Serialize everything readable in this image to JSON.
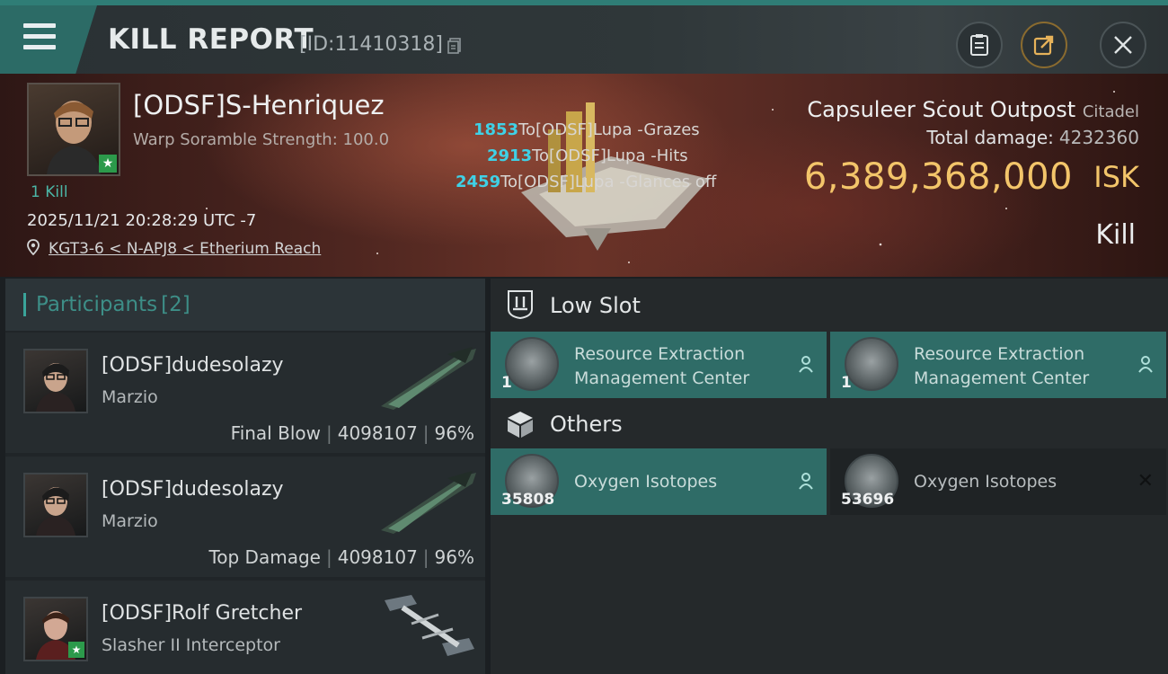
{
  "header": {
    "title": "KILL REPORT",
    "report_id": "[ID:11410318]"
  },
  "victim": {
    "name": "[ODSF]S-Henriquez",
    "scramble": "Warp Soramble Strength: 100.0",
    "kill_count": "1 Kill",
    "datetime": "2025/11/21 20:28:29 UTC -7",
    "location": "KGT3-6 < N-APJ8 < Etherium Reach"
  },
  "damage_log": [
    {
      "amount": "1853",
      "text": "To[ODSF]Lupa -Grazes"
    },
    {
      "amount": "2913",
      "text": "To[ODSF]Lupa -Hits"
    },
    {
      "amount": "2459",
      "text": "To[ODSF]Lupa -Glances off"
    }
  ],
  "target": {
    "name": "Capsuleer Scout Outpost",
    "type": "Citadel",
    "total_damage_label": "Total damage:",
    "total_damage": "4232360",
    "isk_value": "6,389,368,000",
    "isk_label": "ISK",
    "result": "Kill"
  },
  "participants": {
    "label": "Participants",
    "count": "[2]",
    "list": [
      {
        "name": "[ODSF]dudesolazy",
        "ship": "Marzio",
        "role": "Final Blow",
        "damage": "4098107",
        "percent": "96%"
      },
      {
        "name": "[ODSF]dudesolazy",
        "ship": "Marzio",
        "role": "Top Damage",
        "damage": "4098107",
        "percent": "96%"
      },
      {
        "name": "[ODSF]Rolf Gretcher",
        "ship": "Slasher II Interceptor"
      }
    ]
  },
  "modules": {
    "low_slot_title": "Low Slot",
    "others_title": "Others",
    "low_slot": [
      {
        "qty": "1",
        "name": "Resource Extraction Management Center",
        "state": "dropped"
      },
      {
        "qty": "1",
        "name": "Resource Extraction Management Center",
        "state": "dropped"
      }
    ],
    "others": [
      {
        "qty": "35808",
        "name": "Oxygen Isotopes",
        "state": "dropped"
      },
      {
        "qty": "53696",
        "name": "Oxygen Isotopes",
        "state": "destroyed"
      }
    ]
  },
  "colors": {
    "accent_teal": "#2f7d76",
    "isk_gold": "#f3c56a",
    "damage_cyan": "#3fd1e6"
  },
  "icons": [
    "menu-icon",
    "copy-icon",
    "clipboard-icon",
    "share-icon",
    "close-icon",
    "location-pin-icon",
    "low-slot-icon",
    "cargo-box-icon",
    "pilot-icon"
  ]
}
